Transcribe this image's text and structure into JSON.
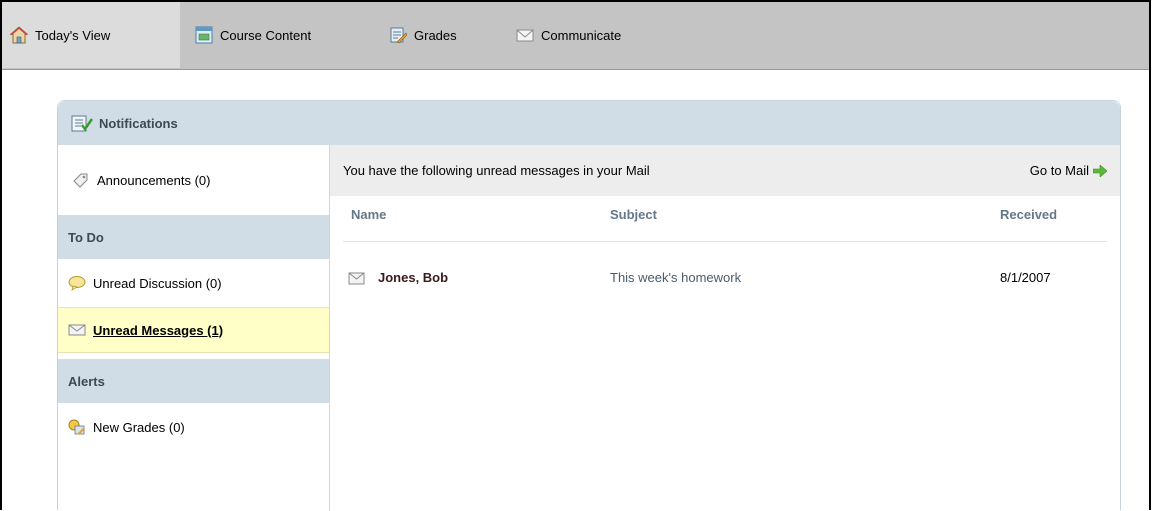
{
  "nav": {
    "tabs": [
      {
        "label": "Today's View",
        "icon": "home-icon",
        "active": true
      },
      {
        "label": "Course Content",
        "icon": "course-content-icon"
      },
      {
        "label": "Grades",
        "icon": "grades-icon"
      },
      {
        "label": "Communicate",
        "icon": "envelope-icon"
      }
    ]
  },
  "panel": {
    "title": "Notifications",
    "icon": "notifications-icon"
  },
  "sidebar": {
    "announcements": "Announcements (0)",
    "todo_header": "To Do",
    "unread_discussion": "Unread Discussion (0)",
    "unread_messages": "Unread Messages (1)",
    "alerts_header": "Alerts",
    "new_grades": "New Grades (0)"
  },
  "main": {
    "message_bar": "You have the following unread messages in your Mail",
    "go_to_mail": "Go to Mail",
    "columns": {
      "name": "Name",
      "subject": "Subject",
      "received": "Received"
    },
    "messages": [
      {
        "name": "Jones, Bob",
        "subject": "This week's homework",
        "received": "8/1/2007"
      }
    ]
  },
  "colors": {
    "panel_header": "#d0dce6",
    "selected_item": "#ffffc7",
    "header_text": "#3c4a55",
    "column_header_text": "#64788a"
  }
}
